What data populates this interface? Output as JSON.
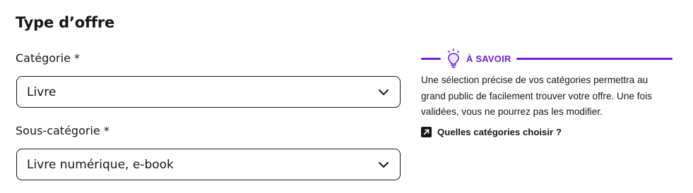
{
  "section": {
    "title": "Type d’offre"
  },
  "fields": {
    "category": {
      "label": "Catégorie *",
      "value": "Livre"
    },
    "subcategory": {
      "label": "Sous-catégorie *",
      "value": "Livre numérique, e-book"
    }
  },
  "info": {
    "title": "À SAVOIR",
    "icon": "lightbulb-icon",
    "text": "Une sélection précise de vos catégories permettra au grand public de facilement trouver votre offre. Une fois validées, vous ne pourrez pas les modifier.",
    "link_label": "Quelles catégories choisir ?",
    "link_icon": "external-link-icon"
  },
  "colors": {
    "accent": "#6a20d4",
    "text": "#161617",
    "border": "#161617"
  }
}
